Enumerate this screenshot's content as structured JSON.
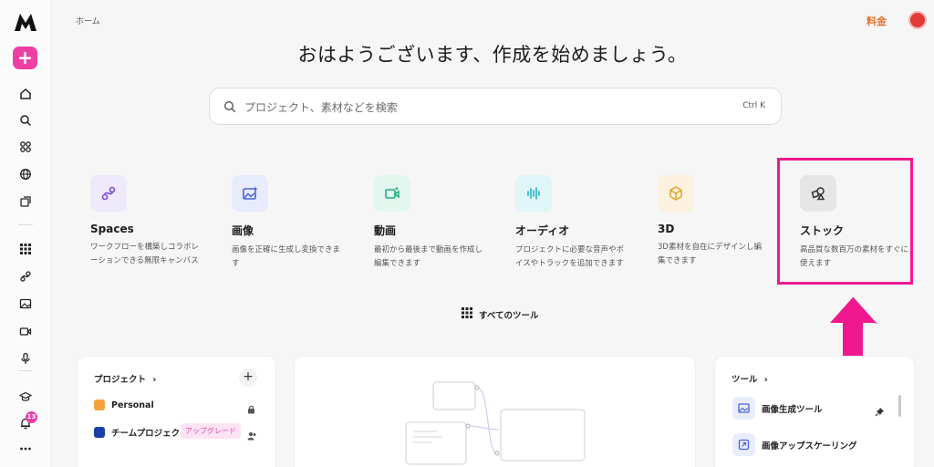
{
  "header": {
    "breadcrumb": "ホーム",
    "pricing_label": "料金"
  },
  "title": "おはようございます、作成を始めましょう。",
  "search": {
    "placeholder": "プロジェクト、素材などを検索",
    "shortcut": "Ctrl K"
  },
  "sidebar": {
    "items": [
      "home-icon",
      "search-icon",
      "apps-icon",
      "globe-icon",
      "library-icon",
      "grid-icon",
      "spaces-icon",
      "image-icon",
      "video-icon",
      "mic-icon",
      "learn-icon",
      "bell-icon",
      "more-icon"
    ],
    "notification_count": "13"
  },
  "cards": [
    {
      "title": "Spaces",
      "desc": "ワークフローを構築しコラボレーションできる無限キャンバス",
      "icon": "spaces-icon",
      "color": "#7c4ddc",
      "bg": "#eeeafb"
    },
    {
      "title": "画像",
      "desc": "画像を正確に生成し変換できます",
      "icon": "image-icon",
      "color": "#4a63e0",
      "bg": "#e7ebfb"
    },
    {
      "title": "動画",
      "desc": "最初から最後まで動画を作成し編集できます",
      "icon": "video-icon",
      "color": "#1fb07e",
      "bg": "#e2f6ee"
    },
    {
      "title": "オーディオ",
      "desc": "プロジェクトに必要な音声やボイスやトラックを追加できます",
      "icon": "audio-icon",
      "color": "#22b3c4",
      "bg": "#e0f5f7"
    },
    {
      "title": "3D",
      "desc": "3D素材を自在にデザインし編集できます",
      "icon": "cube-icon",
      "color": "#e0a62a",
      "bg": "#fbf1de"
    },
    {
      "title": "ストック",
      "desc": "高品質な数百万の素材をすぐに使えます",
      "icon": "shapes-icon",
      "color": "#333333",
      "bg": "#e6e6e6"
    }
  ],
  "all_tools_label": "すべてのツール",
  "projects_panel": {
    "heading": "プロジェクト",
    "items": [
      {
        "name": "Personal",
        "color": "#f5a13a"
      },
      {
        "name": "チームプロジェクト",
        "color": "#1a3fa8",
        "badge": "アップグレード"
      }
    ]
  },
  "tools_panel": {
    "heading": "ツール",
    "items": [
      {
        "name": "画像生成ツール",
        "icon": "image-icon"
      },
      {
        "name": "画像アップスケーリング",
        "icon": "upscale-icon"
      }
    ]
  },
  "colors": {
    "accent": "#ee3fa4",
    "highlight": "#f0188e",
    "pricing": "#e8702a"
  }
}
